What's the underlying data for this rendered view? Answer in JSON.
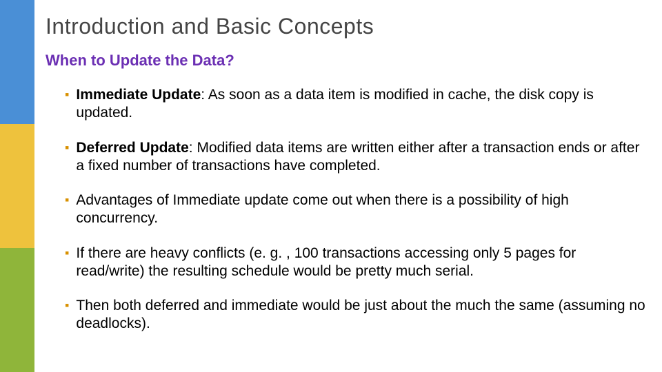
{
  "title": "Introduction and Basic Concepts",
  "subtitle": "When to Update the Data?",
  "sidebar_colors": [
    "#4a8fd6",
    "#eec23d",
    "#8fb53a"
  ],
  "bullets": [
    {
      "strong": "Immediate Update",
      "sep": ":  ",
      "rest": "As soon as a data item is modified in cache, the disk copy is updated."
    },
    {
      "strong": "Deferred Update",
      "sep": ":  ",
      "rest": "Modified data items are written either after a transaction ends or after a fixed number of transactions have completed."
    },
    {
      "strong": "",
      "sep": "",
      "rest": "Advantages of Immediate update come out when there is a possibility of high concurrency."
    },
    {
      "strong": "",
      "sep": "",
      "rest": "If there are heavy conflicts (e. g. , 100 transactions accessing only 5 pages for read/write) the resulting schedule would be pretty much serial."
    },
    {
      "strong": "",
      "sep": " ",
      "rest": "Then both deferred and immediate would be just about the much the same (assuming no deadlocks)."
    }
  ]
}
